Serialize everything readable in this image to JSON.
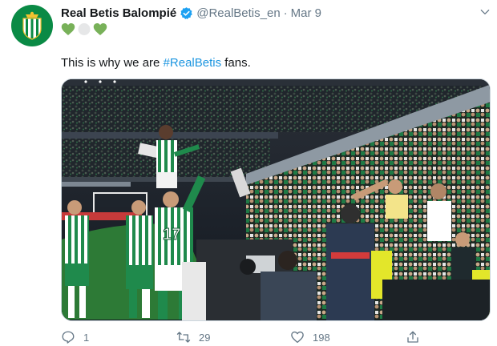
{
  "tweet": {
    "author": {
      "display_name": "Real Betis Balompié",
      "handle": "@RealBetis_en",
      "separator": "·",
      "date": "Mar 9",
      "avatar_icon": "real-betis-crest-icon",
      "verified_icon": "verified-badge-icon"
    },
    "hearts": [
      "green-heart-icon",
      "white-heart-icon",
      "green-heart-icon"
    ],
    "text": {
      "prefix": "This is why we are ",
      "hashtag": "#RealBetis",
      "suffix": " fans."
    },
    "media": {
      "type": "photo",
      "jersey_number": "17"
    },
    "actions": {
      "reply_count": "1",
      "retweet_count": "29",
      "like_count": "198",
      "share_icon": "share-icon"
    }
  },
  "colors": {
    "brand_green": "#0a8a45",
    "link_blue": "#1b95e0",
    "muted_gray": "#657786",
    "verified_blue": "#1da1f2"
  }
}
